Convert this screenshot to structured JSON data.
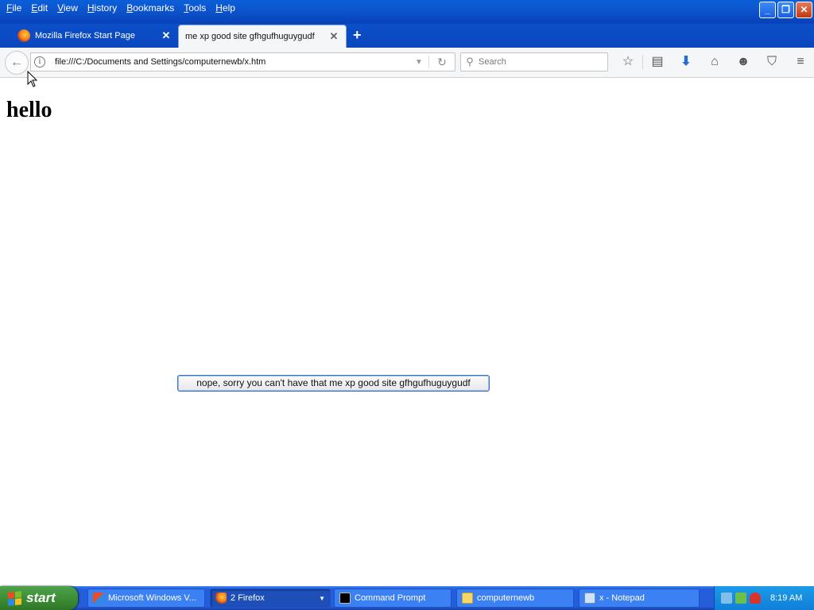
{
  "menu": [
    "File",
    "Edit",
    "View",
    "History",
    "Bookmarks",
    "Tools",
    "Help"
  ],
  "window_controls": {
    "minimize": "_",
    "restore": "❐",
    "close": "✕"
  },
  "tabs": [
    {
      "label": "Mozilla Firefox Start Page",
      "active": false
    },
    {
      "label": "me xp good site gfhgufhuguygudf",
      "active": true
    }
  ],
  "tab_close": "✕",
  "new_tab": "+",
  "navbar": {
    "url": "file:///C:/Documents and Settings/computernewb/x.htm",
    "search_placeholder": "Search"
  },
  "page": {
    "heading": "hello",
    "alert_text": "nope, sorry you can't have that me xp good site gfhgufhuguygudf"
  },
  "taskbar": {
    "start_label": "start",
    "tasks": [
      {
        "label": "Microsoft Windows V...",
        "icon": "windows-update-icon"
      },
      {
        "label": "2 Firefox",
        "icon": "firefox-icon",
        "active": true
      },
      {
        "label": "Command Prompt",
        "icon": "command-prompt-icon"
      },
      {
        "label": "computernewb",
        "icon": "folder-icon"
      },
      {
        "label": "x - Notepad",
        "icon": "notepad-icon"
      }
    ],
    "clock": "8:19 AM"
  },
  "colors": {
    "titlebar": "#0a5fd8",
    "taskbar": "#245edb",
    "start": "#3a8a33",
    "tray": "#0f7fd8",
    "alert_border": "#3d6fc5"
  }
}
